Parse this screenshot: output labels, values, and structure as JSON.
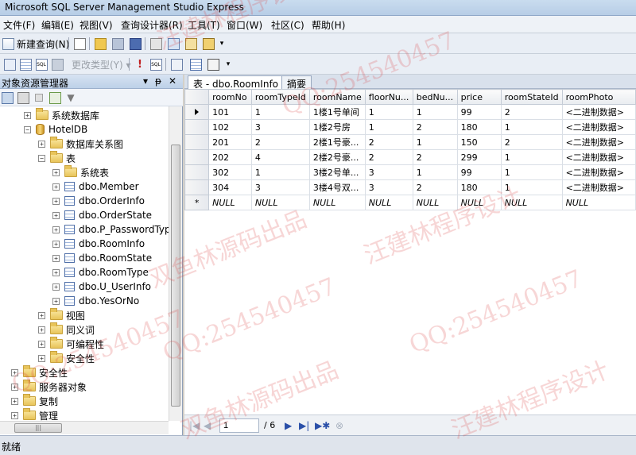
{
  "window": {
    "title": "Microsoft SQL Server Management Studio Express"
  },
  "menu": [
    "文件(F)",
    "编辑(E)",
    "视图(V)",
    "查询设计器(R)",
    "工具(T)",
    "窗口(W)",
    "社区(C)",
    "帮助(H)"
  ],
  "toolbar": {
    "new_query_label": "新建查询(N)",
    "change_type_label": "更改类型(Y) ▾"
  },
  "explorer": {
    "title": "对象资源管理器",
    "pin": "▾ 📌",
    "close": "✕",
    "tree": [
      {
        "label": "系统数据库",
        "expander": "+",
        "icon": "folder-icon"
      },
      {
        "label": "HotelDB",
        "expander": "−",
        "icon": "database-icon"
      },
      {
        "label": "数据库关系图",
        "expander": "+",
        "icon": "folder-icon"
      },
      {
        "label": "表",
        "expander": "−",
        "icon": "folder-icon"
      },
      {
        "label": "系统表",
        "expander": "+",
        "icon": "folder-icon"
      },
      {
        "label": "dbo.Member",
        "expander": "+",
        "icon": "table-icon"
      },
      {
        "label": "dbo.OrderInfo",
        "expander": "+",
        "icon": "table-icon"
      },
      {
        "label": "dbo.OrderState",
        "expander": "+",
        "icon": "table-icon"
      },
      {
        "label": "dbo.P_PasswordType",
        "expander": "+",
        "icon": "table-icon"
      },
      {
        "label": "dbo.RoomInfo",
        "expander": "+",
        "icon": "table-icon"
      },
      {
        "label": "dbo.RoomState",
        "expander": "+",
        "icon": "table-icon"
      },
      {
        "label": "dbo.RoomType",
        "expander": "+",
        "icon": "table-icon"
      },
      {
        "label": "dbo.U_UserInfo",
        "expander": "+",
        "icon": "table-icon"
      },
      {
        "label": "dbo.YesOrNo",
        "expander": "+",
        "icon": "table-icon"
      },
      {
        "label": "视图",
        "expander": "+",
        "icon": "folder-icon"
      },
      {
        "label": "同义词",
        "expander": "+",
        "icon": "folder-icon"
      },
      {
        "label": "可编程性",
        "expander": "+",
        "icon": "folder-icon"
      },
      {
        "label": "安全性",
        "expander": "+",
        "icon": "folder-icon"
      },
      {
        "label": "安全性",
        "expander": "+",
        "icon": "folder-icon"
      },
      {
        "label": "服务器对象",
        "expander": "+",
        "icon": "folder-icon"
      },
      {
        "label": "复制",
        "expander": "+",
        "icon": "folder-icon"
      },
      {
        "label": "管理",
        "expander": "+",
        "icon": "folder-icon"
      }
    ]
  },
  "tabs": [
    {
      "label": "表 - dbo.RoomInfo",
      "active": true
    },
    {
      "label": "摘要",
      "active": false
    }
  ],
  "grid": {
    "columns": [
      "roomNo",
      "roomTypeId",
      "roomName",
      "floorNu...",
      "bedNu...",
      "price",
      "roomStateId",
      "roomPhoto"
    ],
    "rows": [
      [
        "101",
        "1",
        "1楼1号单间",
        "1",
        "1",
        "99",
        "2",
        "<二进制数据>"
      ],
      [
        "102",
        "3",
        "1楼2号房",
        "1",
        "2",
        "180",
        "1",
        "<二进制数据>"
      ],
      [
        "201",
        "2",
        "2楼1号豪...",
        "2",
        "1",
        "150",
        "2",
        "<二进制数据>"
      ],
      [
        "202",
        "4",
        "2楼2号豪...",
        "2",
        "2",
        "299",
        "1",
        "<二进制数据>"
      ],
      [
        "302",
        "1",
        "3楼2号单...",
        "3",
        "1",
        "99",
        "1",
        "<二进制数据>"
      ],
      [
        "304",
        "3",
        "3楼4号双...",
        "3",
        "2",
        "180",
        "1",
        "<二进制数据>"
      ]
    ],
    "new_row": [
      "NULL",
      "NULL",
      "NULL",
      "NULL",
      "NULL",
      "NULL",
      "NULL",
      "NULL"
    ],
    "new_row_marker": "*"
  },
  "navigator": {
    "current": "1",
    "of": "/ 6"
  },
  "status": {
    "text": "就绪"
  },
  "watermarks": [
    "汪建林程序设计",
    "QQ:254540457",
    "双鱼林源码出品",
    "QQ:254540457",
    "汪建林程序设计",
    "QQ:254540457",
    "双鱼林源码出品",
    "QQ:254540457",
    "汪建林程序设计"
  ]
}
